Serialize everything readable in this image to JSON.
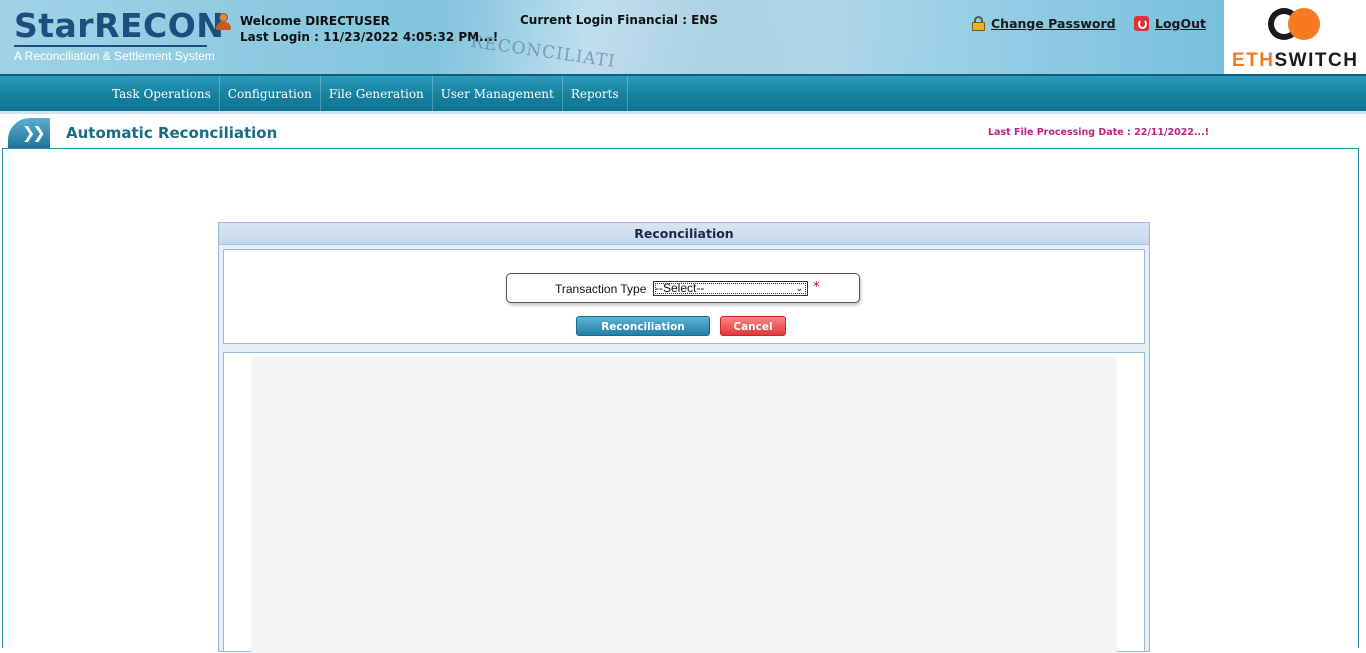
{
  "brand": {
    "name": "StarRECON",
    "tagline": "A Reconciliation & Settlement System",
    "photo_text": "RECONCILIATI"
  },
  "user": {
    "welcome": "Welcome DIRECTUSER",
    "last_login": "Last Login : 11/23/2022 4:05:32 PM...!",
    "financial": "Current Login Financial : ENS"
  },
  "header_links": {
    "change_password": "Change Password",
    "logout": "LogOut"
  },
  "partner_logo": {
    "eth": "ETH",
    "switch": "SWITCH"
  },
  "nav": {
    "items": [
      "Task Operations",
      "Configuration",
      "File Generation",
      "User Management",
      "Reports"
    ]
  },
  "page": {
    "title": "Automatic Reconciliation",
    "last_file_date": "Last File Processing Date : 22/11/2022...!"
  },
  "panel": {
    "title": "Reconciliation",
    "field_label": "Transaction Type",
    "select_value": "--Select--",
    "required_mark": "*",
    "reconcile_button": "Reconciliation",
    "cancel_button": "Cancel"
  },
  "colors": {
    "nav_bg": "#17839f",
    "title_text": "#1c6b86",
    "date_text": "#c0208a",
    "accent_orange": "#f47920"
  },
  "icons": [
    "user-icon",
    "lock-icon",
    "logout-icon",
    "title-arrow-icon",
    "chevron-down-icon"
  ]
}
